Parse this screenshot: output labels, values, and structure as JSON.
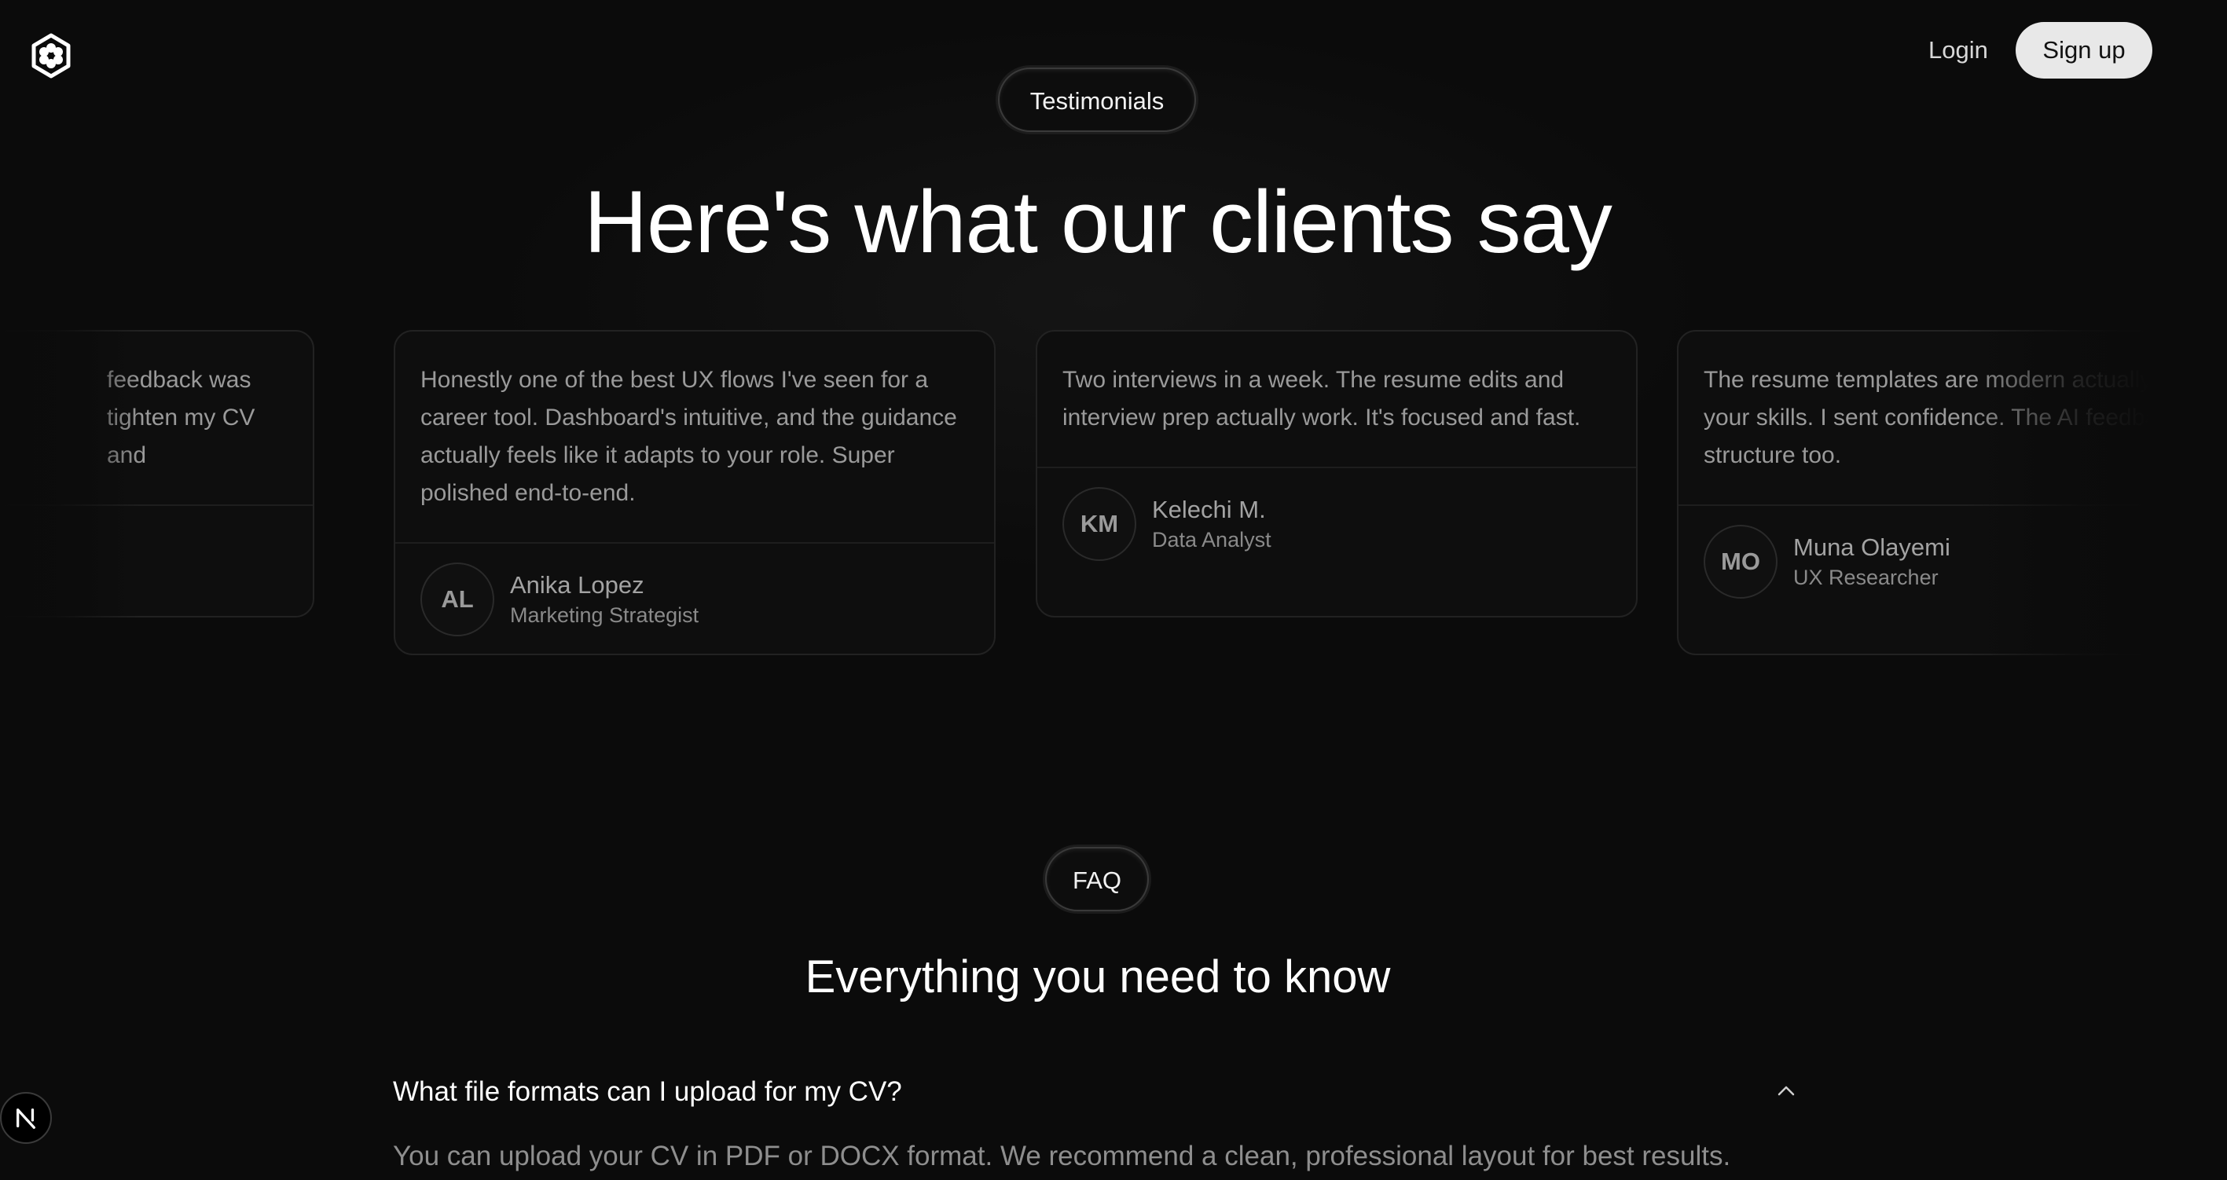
{
  "header": {
    "logo_icon": "hexagon-flower-icon",
    "login_label": "Login",
    "signup_label": "Sign up"
  },
  "testimonials": {
    "pill_label": "Testimonials",
    "heading": "Here's what our clients say",
    "cards": [
      {
        "quote": "feedback was tighten my CV and",
        "initials": "",
        "name": "",
        "role": ""
      },
      {
        "quote": "Honestly one of the best UX flows I've seen for a career tool. Dashboard's intuitive, and the guidance actually feels like it adapts to your role. Super polished end-to-end.",
        "initials": "AL",
        "name": "Anika Lopez",
        "role": "Marketing Strategist"
      },
      {
        "quote": "Two interviews in a week. The resume edits and interview prep actually work. It's focused and fast.",
        "initials": "KM",
        "name": "Kelechi M.",
        "role": "Data Analyst"
      },
      {
        "quote": "The resume templates are modern actually highlight your skills. I sent confidence. The AI feedback nailed structure too.",
        "initials": "MO",
        "name": "Muna Olayemi",
        "role": "UX Researcher"
      }
    ]
  },
  "faq": {
    "pill_label": "FAQ",
    "heading": "Everything you need to know",
    "items": [
      {
        "question": "What file formats can I upload for my CV?",
        "answer": "You can upload your CV in PDF or DOCX format. We recommend a clean, professional layout for best results.",
        "expanded": true
      }
    ]
  },
  "dev_badge": {
    "icon": "nextjs-logo-icon"
  }
}
